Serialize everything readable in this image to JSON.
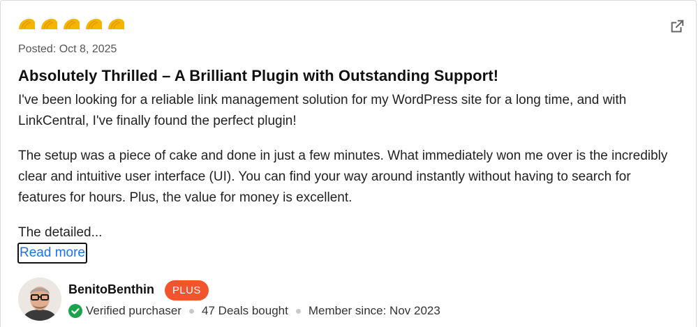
{
  "review": {
    "rating": 5,
    "rating_max": 5,
    "star_color": "#f5b400",
    "posted": "Posted: Oct 8, 2025",
    "title": "Absolutely Thrilled – A Brilliant Plugin with Outstanding Support!",
    "paragraphs": [
      "I've been looking for a reliable link management solution for my WordPress site for a long time, and with LinkCentral, I've finally found the perfect plugin!",
      "The setup was a piece of cake and done in just a few minutes. What immediately won me over is the incredibly clear and intuitive user interface (UI). You can find your way around instantly without having to search for features for hours. Plus, the value for money is excellent.",
      "The detailed..."
    ],
    "read_more": "Read more",
    "external_link_icon": "external-link-icon"
  },
  "author": {
    "name": "BenitoBenthin",
    "badge": "PLUS",
    "badge_color": "#f2552c",
    "verified": "Verified purchaser",
    "verified_color": "#1aa34a",
    "deals": "47 Deals bought",
    "member_since": "Member since: Nov 2023"
  }
}
